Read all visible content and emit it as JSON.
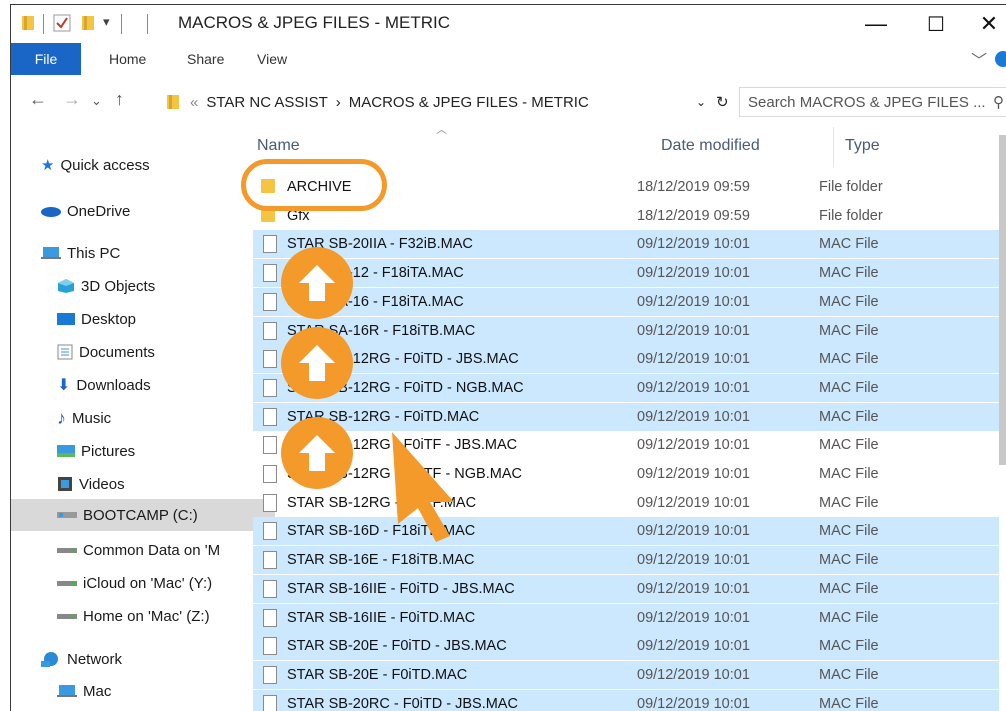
{
  "window": {
    "title": "MACROS & JPEG FILES - METRIC",
    "minimize_glyph": "—",
    "maximize_glyph": "☐",
    "close_glyph": "✕"
  },
  "ribbon": {
    "tabs": [
      "File",
      "Home",
      "Share",
      "View"
    ]
  },
  "address": {
    "path_root": "STAR NC ASSIST",
    "path_current": "MACROS & JPEG FILES - METRIC",
    "search_placeholder": "Search MACROS & JPEG FILES ..."
  },
  "nav": {
    "items": [
      {
        "label": "Quick access",
        "icon": "star-icon"
      },
      {
        "label": "OneDrive",
        "icon": "cloud-icon"
      },
      {
        "label": "This PC",
        "icon": "computer-icon"
      },
      {
        "label": "3D Objects",
        "icon": "cube-icon"
      },
      {
        "label": "Desktop",
        "icon": "desktop-icon"
      },
      {
        "label": "Documents",
        "icon": "documents-icon"
      },
      {
        "label": "Downloads",
        "icon": "download-icon"
      },
      {
        "label": "Music",
        "icon": "music-icon"
      },
      {
        "label": "Pictures",
        "icon": "pictures-icon"
      },
      {
        "label": "Videos",
        "icon": "videos-icon"
      },
      {
        "label": "BOOTCAMP (C:)",
        "icon": "drive-icon"
      },
      {
        "label": "Common Data on 'M",
        "icon": "network-drive-icon"
      },
      {
        "label": "iCloud on 'Mac' (Y:)",
        "icon": "network-drive-icon"
      },
      {
        "label": "Home on 'Mac' (Z:)",
        "icon": "network-drive-icon"
      },
      {
        "label": "Network",
        "icon": "network-icon"
      },
      {
        "label": "Mac",
        "icon": "computer-icon"
      }
    ]
  },
  "columns": {
    "name": "Name",
    "date": "Date modified",
    "type": "Type"
  },
  "files": [
    {
      "name": "ARCHIVE",
      "date": "18/12/2019 09:59",
      "type": "File folder",
      "kind": "folder",
      "selected": false
    },
    {
      "name": "Gfx",
      "date": "18/12/2019 09:59",
      "type": "File folder",
      "kind": "folder",
      "selected": false
    },
    {
      "name": "STAR SB-20IIA - F32iB.MAC",
      "date": "09/12/2019 10:01",
      "type": "MAC File",
      "kind": "file",
      "selected": true
    },
    {
      "name": "STAR SA-12 - F18iTA.MAC",
      "date": "09/12/2019 10:01",
      "type": "MAC File",
      "kind": "file",
      "selected": true
    },
    {
      "name": "STAR SA-16 - F18iTA.MAC",
      "date": "09/12/2019 10:01",
      "type": "MAC File",
      "kind": "file",
      "selected": true
    },
    {
      "name": "STAR SA-16R - F18iTB.MAC",
      "date": "09/12/2019 10:01",
      "type": "MAC File",
      "kind": "file",
      "selected": true
    },
    {
      "name": "STAR SB-12RG - F0iTD - JBS.MAC",
      "date": "09/12/2019 10:01",
      "type": "MAC File",
      "kind": "file",
      "selected": true
    },
    {
      "name": "STAR SB-12RG - F0iTD - NGB.MAC",
      "date": "09/12/2019 10:01",
      "type": "MAC File",
      "kind": "file",
      "selected": true
    },
    {
      "name": "STAR SB-12RG - F0iTD.MAC",
      "date": "09/12/2019 10:01",
      "type": "MAC File",
      "kind": "file",
      "selected": true
    },
    {
      "name": "STAR SB-12RG - F0iTF - JBS.MAC",
      "date": "09/12/2019 10:01",
      "type": "MAC File",
      "kind": "file",
      "selected": false
    },
    {
      "name": "STAR SB-12RG - F0iTF - NGB.MAC",
      "date": "09/12/2019 10:01",
      "type": "MAC File",
      "kind": "file",
      "selected": false
    },
    {
      "name": "STAR SB-12RG - F0iTF.MAC",
      "date": "09/12/2019 10:01",
      "type": "MAC File",
      "kind": "file",
      "selected": false
    },
    {
      "name": "STAR SB-16D - F18iTB.MAC",
      "date": "09/12/2019 10:01",
      "type": "MAC File",
      "kind": "file",
      "selected": true
    },
    {
      "name": "STAR SB-16E - F18iTB.MAC",
      "date": "09/12/2019 10:01",
      "type": "MAC File",
      "kind": "file",
      "selected": true
    },
    {
      "name": "STAR SB-16IIE - F0iTD - JBS.MAC",
      "date": "09/12/2019 10:01",
      "type": "MAC File",
      "kind": "file",
      "selected": true
    },
    {
      "name": "STAR SB-16IIE - F0iTD.MAC",
      "date": "09/12/2019 10:01",
      "type": "MAC File",
      "kind": "file",
      "selected": true
    },
    {
      "name": "STAR SB-20E - F0iTD - JBS.MAC",
      "date": "09/12/2019 10:01",
      "type": "MAC File",
      "kind": "file",
      "selected": true
    },
    {
      "name": "STAR SB-20E - F0iTD.MAC",
      "date": "09/12/2019 10:01",
      "type": "MAC File",
      "kind": "file",
      "selected": true
    },
    {
      "name": "STAR SB-20RC - F0iTD - JBS.MAC",
      "date": "09/12/2019 10:01",
      "type": "MAC File",
      "kind": "file",
      "selected": true
    }
  ],
  "colors": {
    "accent": "#1a66c6",
    "selection": "#cce8ff",
    "annotation": "#f39a2a",
    "folder": "#f4c543"
  }
}
